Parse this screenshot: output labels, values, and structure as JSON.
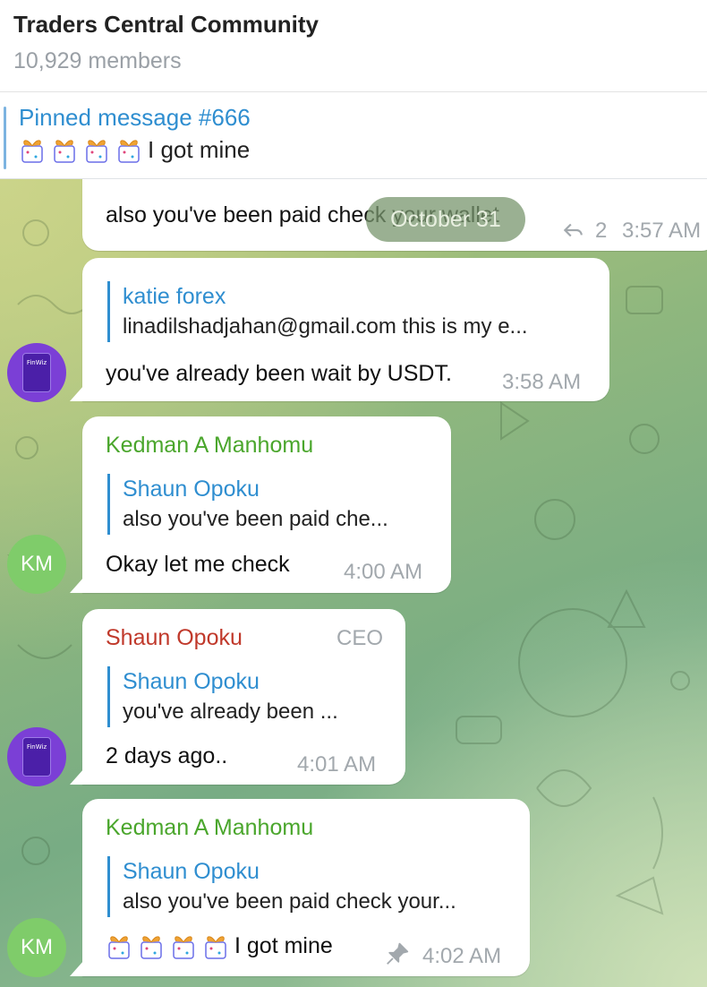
{
  "header": {
    "title": "Traders Central Community",
    "subtitle": "10,929 members"
  },
  "pinned": {
    "title": "Pinned message #666",
    "emoji_count": 4,
    "text": "I got mine"
  },
  "date_chip": "October 31",
  "messages": [
    {
      "text": "also you've been paid check your wallet",
      "reply_count": "2",
      "time": "3:57 AM"
    },
    {
      "reply_name": "katie forex",
      "reply_text": "linadilshadjahan@gmail.com this is my e...",
      "text": "you've already been wait by USDT.",
      "time": "3:58 AM",
      "avatar": "FinWiz"
    },
    {
      "sender": "Kedman A Manhomu",
      "reply_name": "Shaun Opoku",
      "reply_text": "also you've been paid che...",
      "text": "Okay let me check",
      "time": "4:00 AM",
      "avatar": "KM"
    },
    {
      "sender": "Shaun Opoku",
      "badge": "CEO",
      "reply_name": "Shaun Opoku",
      "reply_text": "you've already been ...",
      "text": "2 days ago..",
      "time": "4:01 AM",
      "avatar": "FinWiz"
    },
    {
      "sender": "Kedman A Manhomu",
      "reply_name": "Shaun Opoku",
      "reply_text": "also you've been paid check your...",
      "text": "I got mine",
      "time": "4:02 AM",
      "avatar": "KM"
    }
  ],
  "colors": {
    "accent": "#2f8ed0",
    "sender_green": "#4aa62c",
    "sender_red": "#c0392b",
    "avatar_green": "#7fcc6a"
  }
}
